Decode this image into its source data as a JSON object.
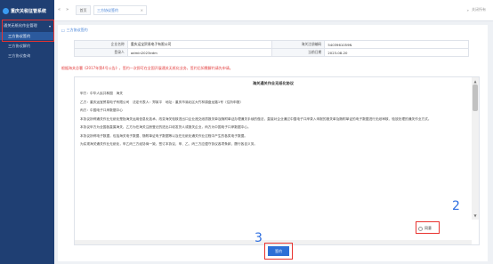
{
  "sidebar": {
    "app_title": "重庆关税征管系统",
    "section_label": "通关无纸化作业管理",
    "items": [
      {
        "label": "三方协议签约"
      },
      {
        "label": "三方协议解约"
      },
      {
        "label": "三方协议查询"
      }
    ]
  },
  "topbar": {
    "home_tab": "首页",
    "current_tab": "三方协议签约",
    "close_glyph": "×",
    "right_text": "关闭所有"
  },
  "breadcrumb": {
    "label": "三方协议签约"
  },
  "info": {
    "enterprise_label": "企业名称",
    "enterprise_value": "重庆运宝贸易电子有限公司",
    "tax_code_label": "海关注册编码",
    "tax_code_value": "5403961059N",
    "login_label": "登录人",
    "login_value": "admin2023edm",
    "date_label": "当前日期",
    "date_value": "2023-08-20"
  },
  "notice": "根据海关总署《2017年第4号公告》，签约一次即可在全国开展通关无纸化业务，签约后如需解约请先申请。",
  "agreement": {
    "title": "海关通关作业无纸化协议",
    "party_a": "甲方：中华人民共和国　海关",
    "party_b": "乙方：重庆运宝贸易电子有限公司　法定代表人：郑某平　地址：重庆市渝北区大竹林镇盘龙路1号（住所申报）",
    "party_c": "丙方：中国电子口岸数据中心",
    "para1": "本协议所称通关作业无纸化是指海关运用信息化技术，改变海关验核进出口企业递交纸质报关单及随附单证办理通关手续的做法，直接对企业通过中国电子口岸录入申报的报关单及随附单证的电子数据进行无纸审核、验放处理的通关作业方式。",
    "para2": "本协议甲方为全国各直属海关，乙方为在海关注册登记的进出口收发货人或报关企业，丙方为中国电子口岸数据中心。",
    "para3": "本协议所称电子数据，包括海关电子数据、随附单证电子数据等以及在无纸化通关作业过程中产生的各类电子数据。",
    "para4": "为实现海关通关作业无纸化，甲乙丙三方经协商一致，签订本协议，甲、乙、丙三方应遵守协议各项条款，履行各自义务。"
  },
  "agree_option_label": "同意",
  "sign_button_label": "签约",
  "annotations": {
    "step2": "2",
    "step3": "3"
  },
  "colors": {
    "sidebar_bg": "#1f3f73",
    "accent": "#2d6fd6",
    "notice_red": "#e23b3b",
    "annotation_red": "#e8332f",
    "annotation_blue": "#2f6fe0"
  }
}
